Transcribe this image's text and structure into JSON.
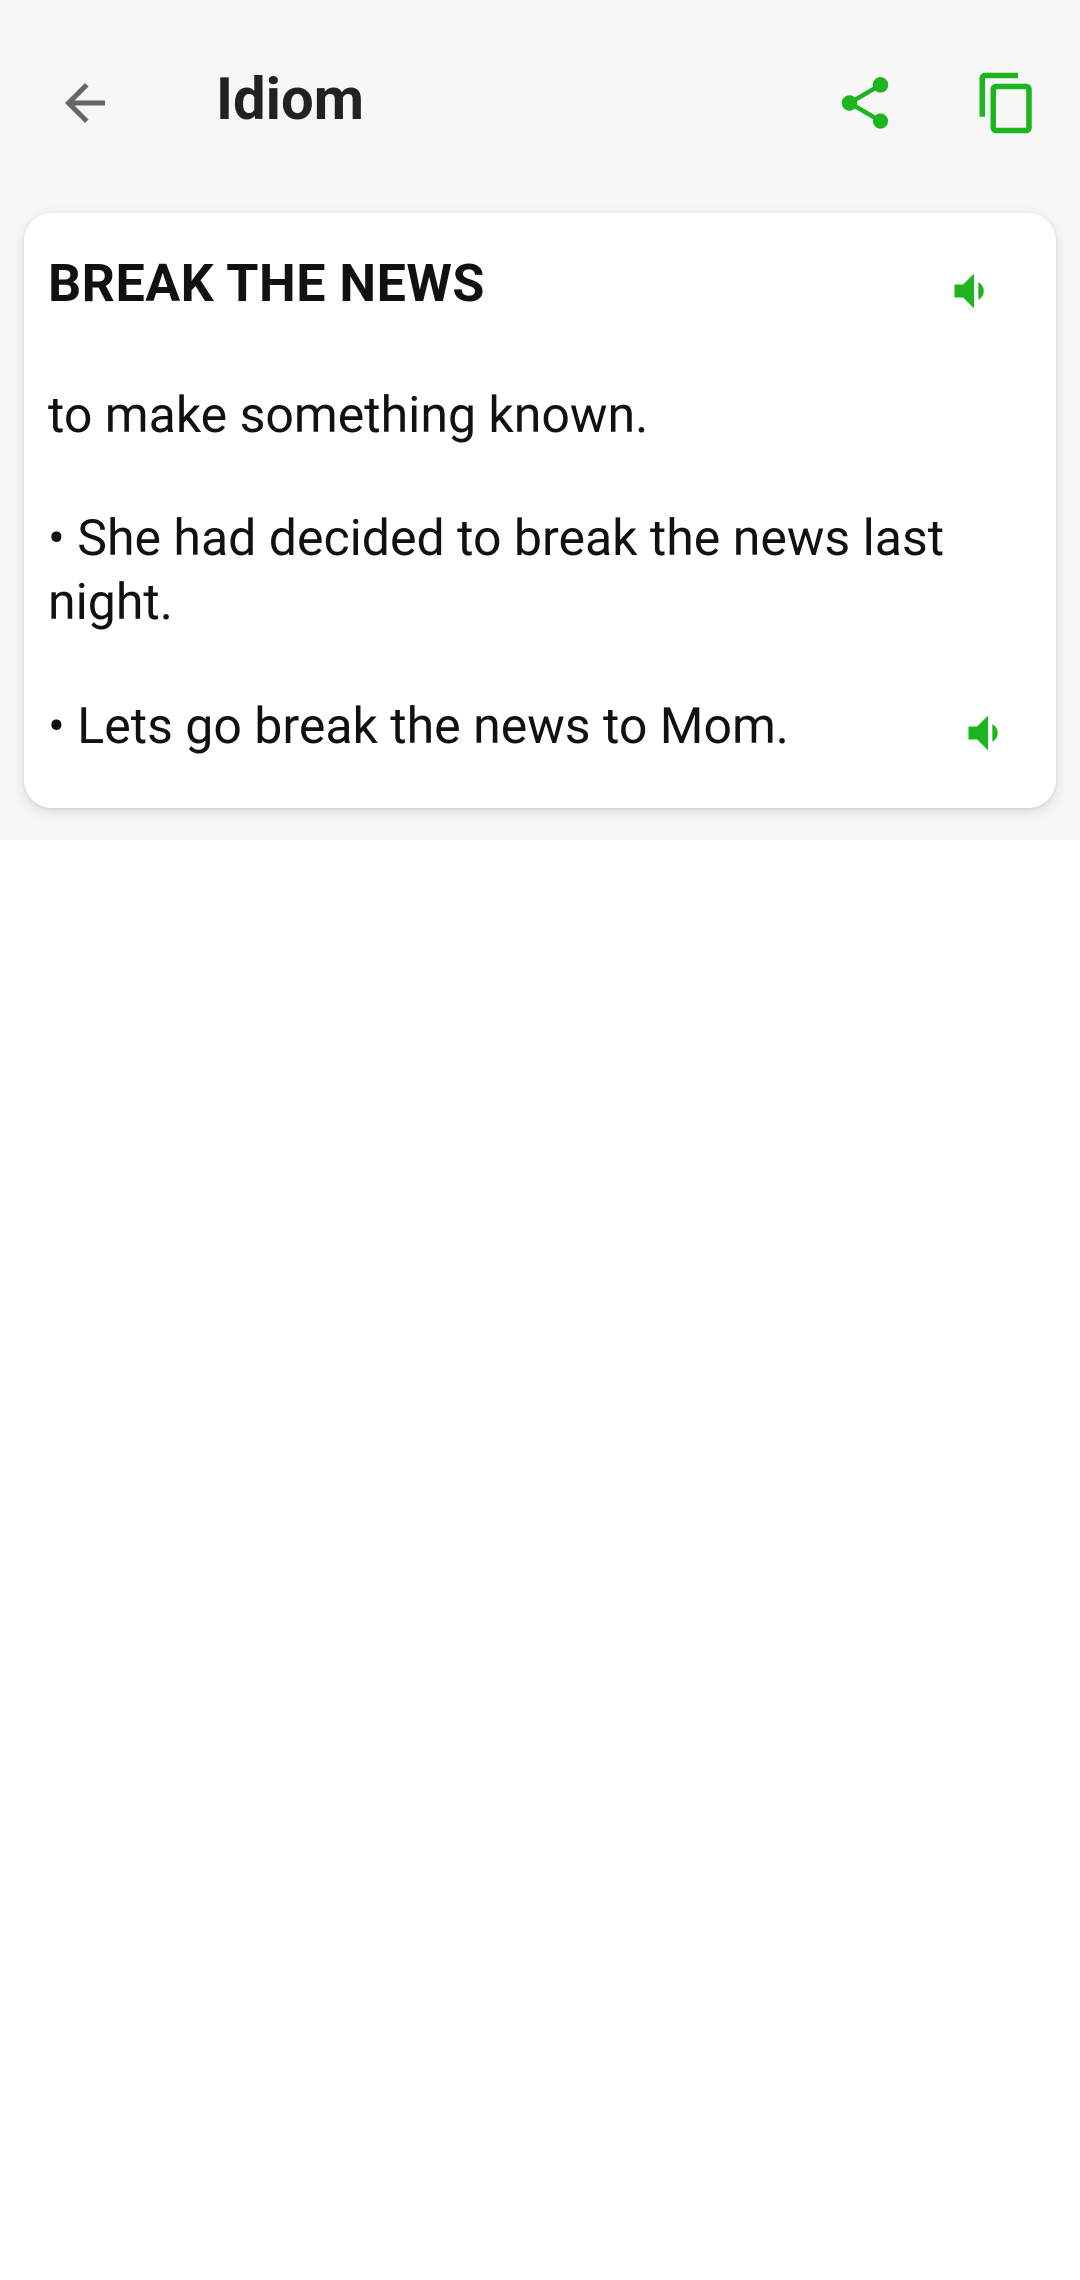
{
  "app": {
    "title": "Idiom"
  },
  "toolbar": {
    "back_icon": "arrow-left-icon",
    "share_icon": "share-icon",
    "copy_icon": "copy-icon"
  },
  "card": {
    "idiom": "BREAK THE NEWS",
    "meaning": "to make something known.",
    "examples": [
      "• She had decided to break the news last night.",
      "• Lets go break the news to Mom."
    ],
    "speak_icon": "speaker-icon"
  },
  "colors": {
    "accent": "#1DB51D",
    "icon_gray": "#666666",
    "header_bg": "#f7f7f7"
  }
}
